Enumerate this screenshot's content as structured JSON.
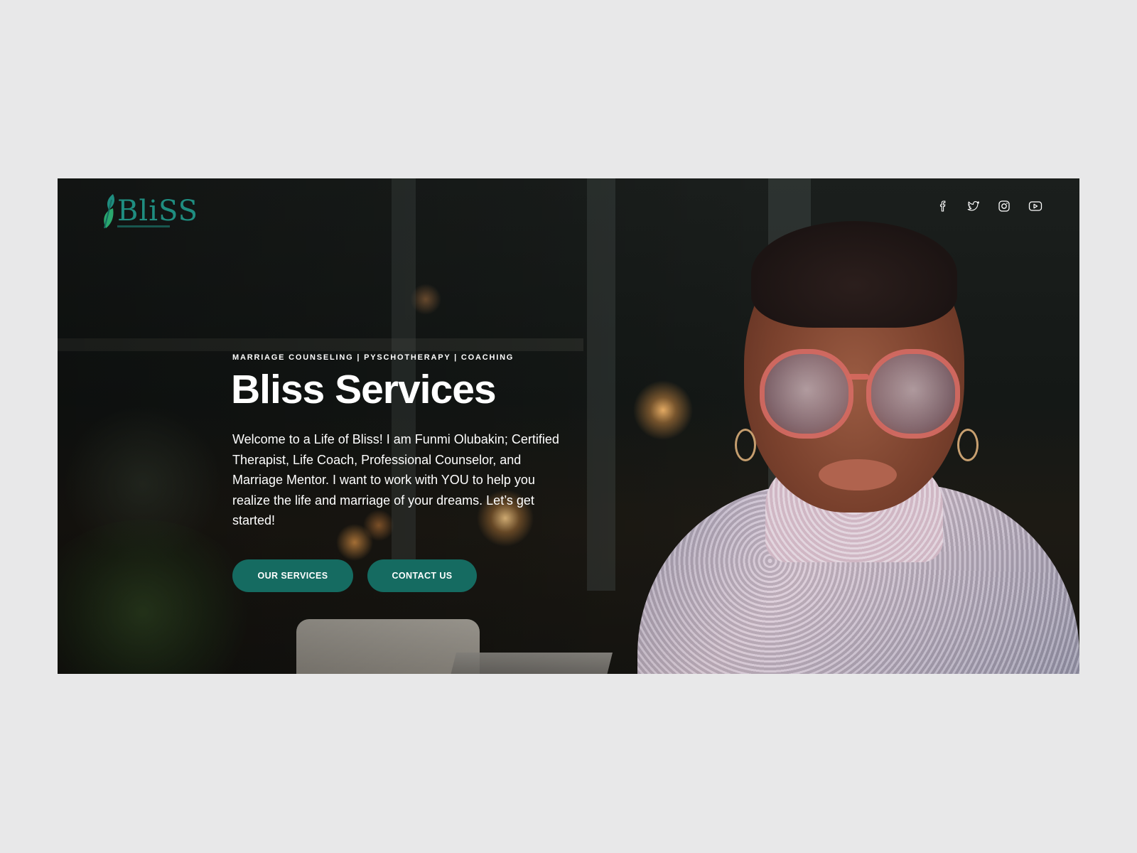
{
  "brand": {
    "logo_text": "BliSS",
    "accent_color": "#1f8d80",
    "button_color": "#156b61"
  },
  "social": [
    {
      "icon": "facebook-icon"
    },
    {
      "icon": "twitter-icon"
    },
    {
      "icon": "instagram-icon"
    },
    {
      "icon": "youtube-icon"
    }
  ],
  "hero": {
    "kicker": "MARRIAGE COUNSELING | PYSCHOTHERAPY | COACHING",
    "title": "Bliss Services",
    "intro": "Welcome to a Life of Bliss! I am Funmi Olubakin; Certified Therapist, Life Coach, Professional Counselor, and Marriage Mentor. I want to work with YOU to help you realize the life and marriage of your dreams. Let’s get started!",
    "buttons": {
      "services": "OUR SERVICES",
      "contact": "CONTACT US"
    }
  }
}
